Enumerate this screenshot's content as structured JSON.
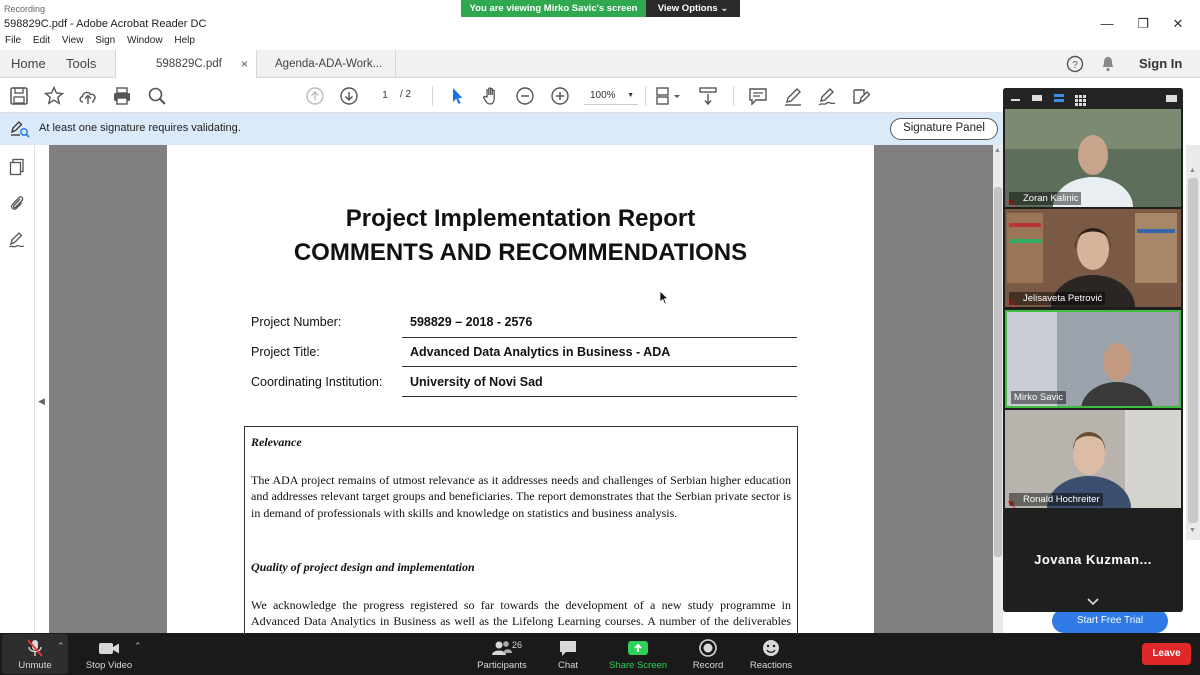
{
  "window": {
    "title": "598829C.pdf - Adobe Acrobat Reader DC",
    "recording_label": "Recording"
  },
  "zoom_banner": {
    "sharing_text": "You are viewing Mirko Savic's screen",
    "view_options_label": "View Options"
  },
  "menu": {
    "items": [
      "File",
      "Edit",
      "View",
      "Sign",
      "Window",
      "Help"
    ]
  },
  "tabs": {
    "home_label": "Home",
    "tools_label": "Tools",
    "documents": [
      {
        "label": "598829C.pdf",
        "close": "×"
      },
      {
        "label": "Agenda-ADA-Work..."
      }
    ],
    "sign_in_label": "Sign In"
  },
  "toolbar": {
    "page_current": "1",
    "page_total": "/ 2",
    "zoom_value": "100%"
  },
  "signature_bar": {
    "message": "At least one signature requires validating.",
    "panel_button": "Signature Panel"
  },
  "document": {
    "title_line1": "Project Implementation Report",
    "title_line2": "COMMENTS AND RECOMMENDATIONS",
    "fields": [
      {
        "label": "Project Number:",
        "value": "598829 – 2018 - 2576"
      },
      {
        "label": "Project Title:",
        "value": "Advanced Data Analytics in Business - ADA"
      },
      {
        "label": "Coordinating Institution:",
        "value": "University of Novi Sad"
      }
    ],
    "sections": [
      {
        "title": "Relevance",
        "text": "The ADA project remains of utmost relevance as it addresses needs and challenges of Serbian higher education and addresses relevant target groups and beneficiaries.  The report demonstrates that the Serbian private sector is in demand of professionals with skills and knowledge on statistics and business analysis."
      },
      {
        "title": "Quality of project design and implementation",
        "text": "We acknowledge the progress registered so far towards the development of a new study programme in Advanced Data Analytics in Business as well as the Lifelong Learning courses. A number of the deliverables that had been planned for the first half of the project have been  produced, in particular"
      }
    ]
  },
  "right_panel": {
    "free_trial_label": "Start Free Trial"
  },
  "participants": {
    "tiles": [
      {
        "name": "Zoran Kalinic",
        "bg": "#5d6f5a",
        "face": "#c9a48c",
        "shirt": "#e9eef3"
      },
      {
        "name": "Jelisaveta Petrović",
        "bg": "#7a5a44",
        "face": "#d7b39b",
        "shirt": "#2a2624"
      },
      {
        "name": "Mirko Savic",
        "bg": "#9aa3ab",
        "face": "#c49a80",
        "shirt": "#3a3a3a"
      },
      {
        "name": "Ronald Hochreiter",
        "bg": "#b8b4ad",
        "face": "#dcbca5",
        "shirt": "#3d4f6e"
      }
    ],
    "audio_only_name": "Jovana  Kuzman..."
  },
  "zoom_bar": {
    "unmute_label": "Unmute",
    "stop_video_label": "Stop Video",
    "participants_label": "Participants",
    "participants_count": "26",
    "chat_label": "Chat",
    "share_label": "Share Screen",
    "record_label": "Record",
    "reactions_label": "Reactions",
    "leave_label": "Leave"
  },
  "colors": {
    "share_green": "#2fa84f",
    "leave_red": "#e02828",
    "acrobat_info_blue": "#dbeaf9",
    "select_tool_blue": "#1a73e8"
  }
}
